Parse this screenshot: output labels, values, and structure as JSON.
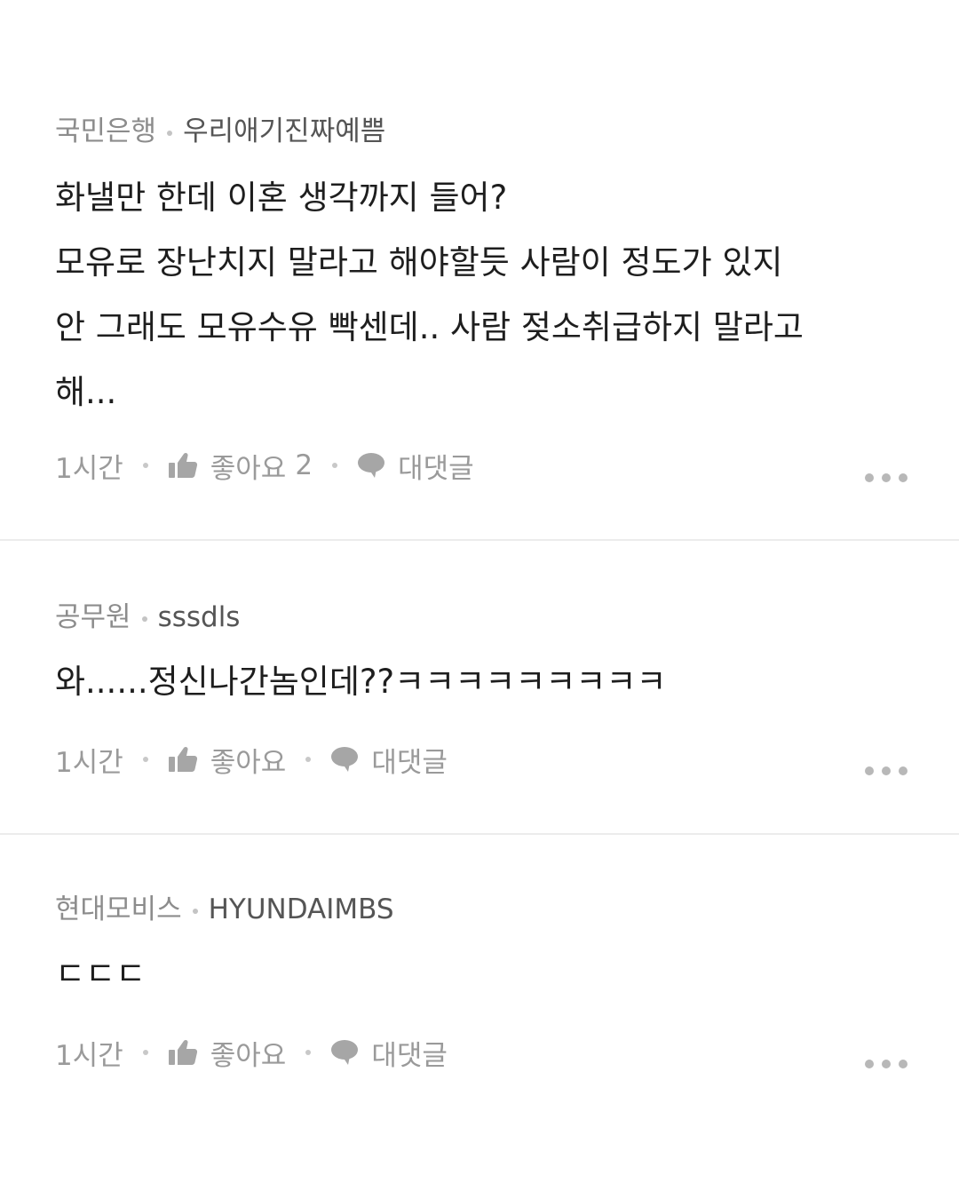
{
  "comments": [
    {
      "company": "국민은행",
      "nickname": "우리애기진짜예쁨",
      "text": "화낼만 한데 이혼 생각까지 들어?\n모유로 장난치지 말라고 해야할듯 사람이 정도가 있지\n안 그래도 모유수유 빡센데.. 사람 젖소취급하지 말라고\n해...",
      "time": "1시간",
      "like_label": "좋아요",
      "like_count": "2",
      "reply_label": "대댓글"
    },
    {
      "company": "공무원",
      "nickname": "sssdls",
      "text": "와......정신나간놈인데??ㅋㅋㅋㅋㅋㅋㅋㅋㅋ",
      "time": "1시간",
      "like_label": "좋아요",
      "like_count": "",
      "reply_label": "대댓글"
    },
    {
      "company": "현대모비스",
      "nickname": "HYUNDAIMBS",
      "text": "ㄷㄷㄷ",
      "time": "1시간",
      "like_label": "좋아요",
      "like_count": "",
      "reply_label": "대댓글"
    }
  ],
  "icons": {
    "like": "thumbs-up-icon",
    "reply": "speech-bubble-icon",
    "more": "more-dots-icon"
  },
  "colors": {
    "meta_company": "#8c8c8c",
    "meta_nickname": "#555555",
    "body_text": "#1e1e1e",
    "action_text": "#9a9a9a",
    "icon": "#a6a6a6",
    "divider": "#ececec"
  }
}
